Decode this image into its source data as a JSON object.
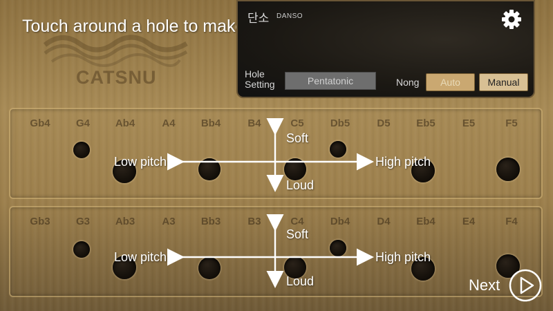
{
  "instruction": "Touch around a hole to make a sound.",
  "brand": {
    "logo_text": "CATSNU"
  },
  "panel": {
    "title": "단소",
    "subtitle": "DANSO",
    "hole_setting_label": "Hole\nSetting",
    "hole_setting_value": "Pentatonic",
    "nong_label": "Nong",
    "auto_label": "Auto",
    "manual_label": "Manual"
  },
  "row1": {
    "notes": [
      "Gb4",
      "G4",
      "Ab4",
      "A4",
      "Bb4",
      "B4",
      "C5",
      "Db5",
      "D5",
      "Eb5",
      "E5",
      "F5"
    ],
    "soft": "Soft",
    "loud": "Loud",
    "low": "Low pitch",
    "high": "High pitch"
  },
  "row2": {
    "notes": [
      "Gb3",
      "G3",
      "Ab3",
      "A3",
      "Bb3",
      "B3",
      "C4",
      "Db4",
      "D4",
      "Eb4",
      "E4",
      "F4"
    ],
    "soft": "Soft",
    "loud": "Loud",
    "low": "Low pitch",
    "high": "High pitch"
  },
  "next_label": "Next",
  "icons": {
    "settings": "gear-icon",
    "next": "play-circle-icon"
  }
}
